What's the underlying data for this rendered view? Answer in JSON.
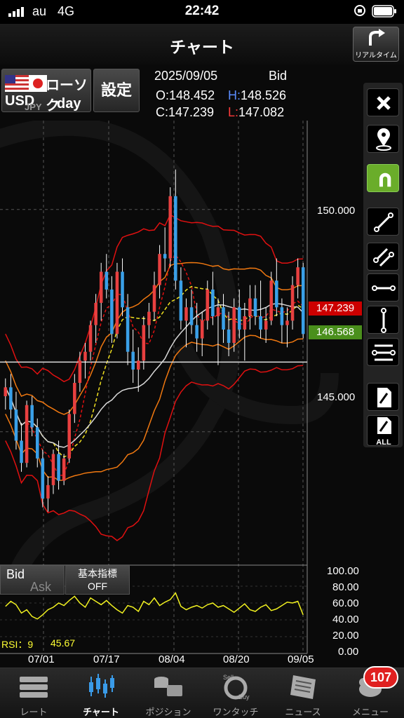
{
  "status_bar": {
    "carrier": "au",
    "network": "4G",
    "time": "22:42"
  },
  "nav": {
    "title": "チャート",
    "realtime_label": "リアルタイム"
  },
  "pair": {
    "base": "USD",
    "quote": "JPY",
    "chart_type": "ローソク",
    "timeframe": "day"
  },
  "settings_label": "設定",
  "ohlc": {
    "date": "2025/09/05",
    "side": "Bid",
    "open_label": "O:",
    "open": "148.452",
    "high_label": "H:",
    "high": "148.526",
    "close_label": "C:",
    "close": "147.239",
    "low_label": "L:",
    "low": "147.082"
  },
  "price_axis": [
    "150.000",
    "145.000"
  ],
  "price_tags": {
    "close": "147.239",
    "line": "146.568"
  },
  "rsi_axis": [
    "100.00",
    "80.00",
    "60.00",
    "40.00",
    "20.00",
    "0.00"
  ],
  "x_axis": [
    "07/01",
    "07/17",
    "08/04",
    "08/20",
    "09/05"
  ],
  "bid_ask": {
    "bid": "Bid",
    "ask": "Ask"
  },
  "indicator_btn": {
    "line1": "基本指標",
    "line2": "OFF"
  },
  "rsi": {
    "label": "RSI：9",
    "value": "45.67"
  },
  "tabs": [
    {
      "label": "レート",
      "icon": "rate-icon"
    },
    {
      "label": "チャート",
      "icon": "chart-icon"
    },
    {
      "label": "ポジション",
      "icon": "position-icon"
    },
    {
      "label": "ワンタッチ",
      "icon": "one-touch-icon"
    },
    {
      "label": "ニュース",
      "icon": "news-icon"
    },
    {
      "label": "メニュー",
      "icon": "menu-icon"
    }
  ],
  "menu_badge": "107",
  "colors": {
    "up": "#e84040",
    "down": "#3aa0e8",
    "bb2": "#e01010",
    "bb1": "#f07810",
    "ma_short": "#f0e020",
    "ma_long": "#d8d8d8",
    "rsi": "#f0f020"
  },
  "chart_data": {
    "type": "candlestick",
    "y_range": [
      142.0,
      152.0
    ],
    "rsi_range": [
      0,
      100
    ],
    "candles": [
      [
        145.8,
        146.2,
        145.5,
        146.0
      ],
      [
        146.0,
        146.3,
        145.3,
        145.5
      ],
      [
        145.5,
        145.9,
        144.6,
        144.8
      ],
      [
        144.8,
        145.2,
        144.1,
        144.3
      ],
      [
        144.3,
        145.7,
        144.2,
        145.6
      ],
      [
        145.6,
        145.8,
        144.9,
        145.1
      ],
      [
        145.1,
        145.3,
        144.2,
        144.4
      ],
      [
        144.4,
        144.6,
        143.3,
        143.5
      ],
      [
        143.5,
        144.0,
        143.2,
        143.8
      ],
      [
        143.8,
        144.6,
        143.6,
        144.5
      ],
      [
        144.5,
        144.8,
        143.7,
        143.9
      ],
      [
        143.9,
        144.5,
        143.8,
        144.4
      ],
      [
        144.4,
        145.5,
        144.3,
        145.4
      ],
      [
        145.4,
        146.3,
        145.2,
        146.1
      ],
      [
        146.1,
        146.8,
        145.9,
        146.6
      ],
      [
        146.6,
        147.0,
        146.2,
        146.8
      ],
      [
        146.8,
        147.5,
        146.6,
        147.4
      ],
      [
        147.4,
        148.1,
        147.0,
        147.9
      ],
      [
        147.9,
        148.8,
        147.5,
        148.6
      ],
      [
        148.6,
        149.0,
        148.0,
        148.2
      ],
      [
        148.2,
        148.5,
        147.0,
        147.2
      ],
      [
        147.2,
        148.8,
        147.1,
        148.6
      ],
      [
        148.6,
        148.9,
        147.6,
        147.8
      ],
      [
        147.8,
        148.1,
        146.5,
        146.8
      ],
      [
        146.8,
        147.3,
        146.1,
        146.4
      ],
      [
        146.4,
        146.9,
        145.9,
        146.6
      ],
      [
        146.6,
        147.6,
        146.4,
        147.4
      ],
      [
        147.4,
        147.9,
        147.1,
        147.7
      ],
      [
        147.7,
        148.6,
        147.5,
        148.3
      ],
      [
        148.3,
        149.2,
        148.0,
        149.0
      ],
      [
        149.0,
        149.6,
        148.6,
        148.9
      ],
      [
        148.9,
        150.5,
        148.7,
        150.3
      ],
      [
        150.3,
        150.9,
        148.2,
        148.4
      ],
      [
        148.4,
        148.7,
        147.3,
        147.5
      ],
      [
        147.5,
        148.0,
        146.9,
        147.8
      ],
      [
        147.8,
        148.2,
        147.2,
        147.4
      ],
      [
        147.4,
        147.9,
        146.8,
        147.1
      ],
      [
        147.1,
        147.7,
        146.7,
        147.5
      ],
      [
        147.5,
        148.4,
        147.3,
        148.2
      ],
      [
        148.2,
        148.6,
        147.4,
        147.6
      ],
      [
        147.6,
        148.0,
        146.5,
        147.8
      ],
      [
        147.8,
        148.1,
        147.0,
        147.3
      ],
      [
        147.3,
        147.7,
        146.7,
        147.0
      ],
      [
        147.0,
        148.0,
        146.8,
        147.8
      ],
      [
        147.8,
        148.2,
        147.1,
        147.3
      ],
      [
        147.3,
        147.9,
        146.6,
        147.6
      ],
      [
        147.6,
        148.3,
        147.3,
        148.0
      ],
      [
        148.0,
        148.3,
        147.4,
        147.6
      ],
      [
        147.6,
        148.4,
        147.1,
        147.3
      ],
      [
        147.3,
        147.8,
        147.0,
        147.5
      ],
      [
        147.5,
        148.6,
        147.4,
        148.4
      ],
      [
        148.4,
        148.9,
        147.6,
        147.8
      ],
      [
        147.8,
        148.0,
        147.0,
        147.4
      ],
      [
        147.4,
        147.8,
        146.9,
        147.5
      ],
      [
        147.5,
        148.5,
        147.3,
        148.3
      ],
      [
        148.3,
        148.9,
        148.0,
        148.7
      ],
      [
        148.7,
        148.8,
        147.1,
        147.2
      ]
    ],
    "rsi": [
      56,
      62,
      58,
      48,
      52,
      44,
      41,
      46,
      52,
      55,
      60,
      57,
      63,
      68,
      60,
      55,
      66,
      62,
      58,
      63,
      57,
      52,
      48,
      57,
      55,
      50,
      62,
      58,
      66,
      57,
      61,
      64,
      72,
      56,
      52,
      55,
      57,
      54,
      58,
      60,
      55,
      57,
      53,
      49,
      54,
      59,
      52,
      50,
      55,
      58,
      51,
      53,
      57,
      61,
      60,
      62,
      46
    ]
  }
}
